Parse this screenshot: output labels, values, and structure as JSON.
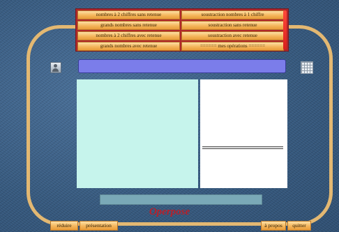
{
  "menu": {
    "items": [
      "nombres à  2 chiffres sans retenue",
      "soustraction nombres à 1 chiffre",
      "grands nombres sans retenue",
      "soustraction sans retenue",
      "nombres à 2 chiffres avec retenue",
      "soustraction avec retenue",
      "grands nombres avec retenue",
      "====== mes opérations ======"
    ]
  },
  "app": {
    "title": "Operpose"
  },
  "buttons": {
    "reduce": "réduire",
    "presentation": "présentation",
    "about": "à propos",
    "quit": "quitter"
  },
  "icons": {
    "left": "person-icon",
    "right": "grid-icon"
  }
}
